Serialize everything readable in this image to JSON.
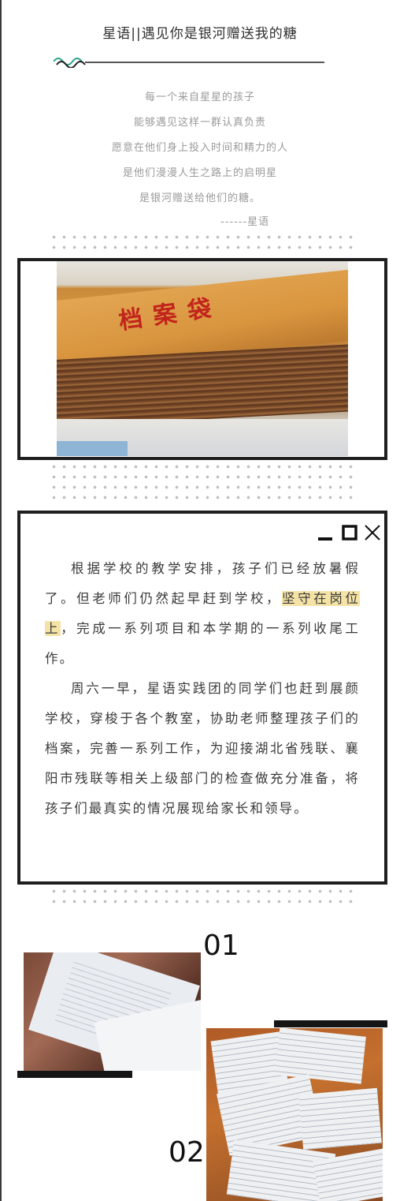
{
  "header": {
    "title": "星语||遇见你是银河赠送我的糖"
  },
  "poem": {
    "lines": [
      "每一个来自星星的孩子",
      "能够遇见这样一群认真负责",
      "愿意在他们身上投入时间和精力的人",
      "是他们漫漫人生之路上的启明星",
      "是银河赠送给他们的糖。"
    ],
    "signature": "------星语"
  },
  "photos": {
    "archive_text": "档案袋"
  },
  "article": {
    "p1_before": "根据学校的教学安排，孩子们已经放暑假了。但老师们仍然起早赶到学校，",
    "p1_highlight": "坚守在岗位上",
    "p1_after": "，完成一系列项目和本学期的一系列收尾工作。",
    "p2": "周六一早，星语实践团的同学们也赶到展颜学校，穿梭于各个教室，协助老师整理孩子们的档案，完善一系列工作，为迎接湖北省残联、襄阳市残联等相关上级部门的检查做充分准备，将孩子们最真实的情况展现给家长和领导。"
  },
  "gallery": {
    "num1": "01",
    "num2": "02"
  },
  "window_icons": [
    "minimize-icon",
    "maximize-icon",
    "close-icon"
  ],
  "colors": {
    "highlight": "#f5e3a6",
    "frame": "#1f1f1f",
    "title_rule_wave": "#2aa58b"
  }
}
